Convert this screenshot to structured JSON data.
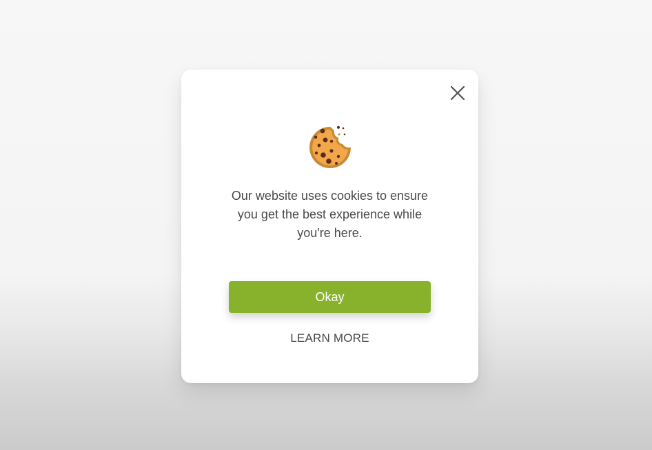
{
  "dialog": {
    "message_lines": [
      "Our website uses cookies to ensure",
      "you get the best experience while",
      "you're here."
    ],
    "okay_label": "Okay",
    "learn_more_label": "LEARN MORE",
    "close_icon": "close-icon",
    "cookie_icon": "cookie-icon",
    "accent_color": "#88b22b"
  }
}
